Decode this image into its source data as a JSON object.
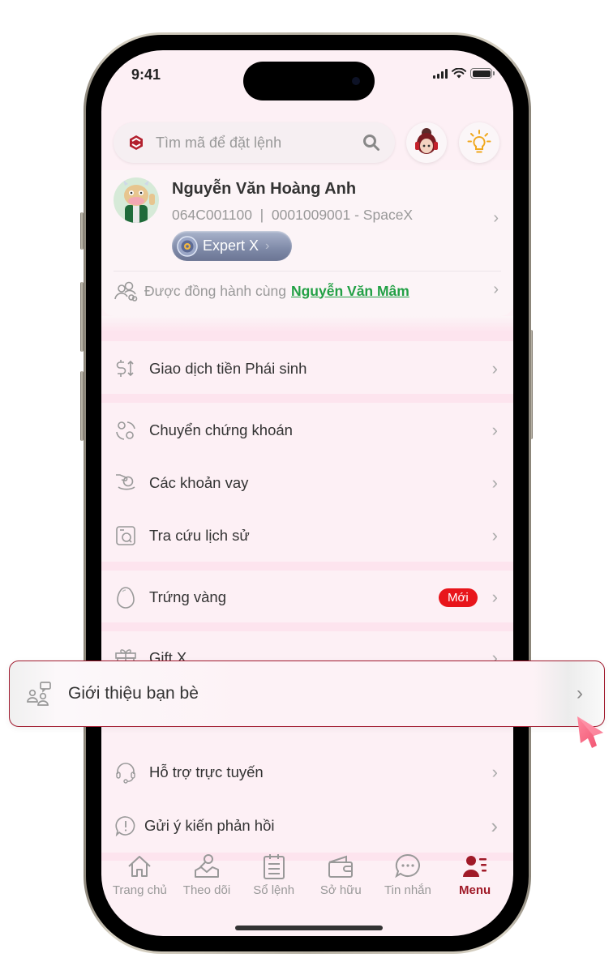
{
  "status_bar": {
    "time": "9:41"
  },
  "search": {
    "placeholder": "Tìm mã để đặt lệnh"
  },
  "profile": {
    "name": "Nguyễn Văn Hoàng Anh",
    "account": "064C001100  |  0001009001 - SpaceX",
    "tier": "Expert X",
    "companion_prefix": "Được đồng hành cùng",
    "companion_name": "Nguyễn Văn Mâm"
  },
  "menu": {
    "items": [
      {
        "label": "Giao dịch tiền Phái sinh",
        "icon": "dollar-transfer-icon"
      },
      {
        "label": "Chuyển chứng khoán",
        "icon": "stock-transfer-icon"
      },
      {
        "label": "Các khoản vay",
        "icon": "loan-icon"
      },
      {
        "label": "Tra cứu lịch sử",
        "icon": "history-lookup-icon"
      },
      {
        "label": "Trứng vàng",
        "icon": "egg-icon",
        "badge": "Mới"
      },
      {
        "label": "Gift X",
        "icon": "gift-icon"
      },
      {
        "label": "Giới thiệu bạn bè",
        "icon": "refer-friends-icon"
      },
      {
        "label": "Hỗ trợ trực tuyến",
        "icon": "headset-icon"
      },
      {
        "label": "Gửi ý kiến phản hồi",
        "icon": "feedback-icon"
      }
    ]
  },
  "tabs": [
    {
      "label": "Trang chủ",
      "icon": "home-icon"
    },
    {
      "label": "Theo dõi",
      "icon": "watchlist-icon"
    },
    {
      "label": "Sổ lệnh",
      "icon": "order-book-icon"
    },
    {
      "label": "Sở hữu",
      "icon": "wallet-icon"
    },
    {
      "label": "Tin nhắn",
      "icon": "message-icon"
    },
    {
      "label": "Menu",
      "icon": "menu-user-icon",
      "active": true
    }
  ],
  "colors": {
    "brand": "#a01a28",
    "new_badge": "#e8151b",
    "link_green": "#22a045",
    "screen_bg": "#fdf0f5",
    "separator": "#fde4ee"
  }
}
